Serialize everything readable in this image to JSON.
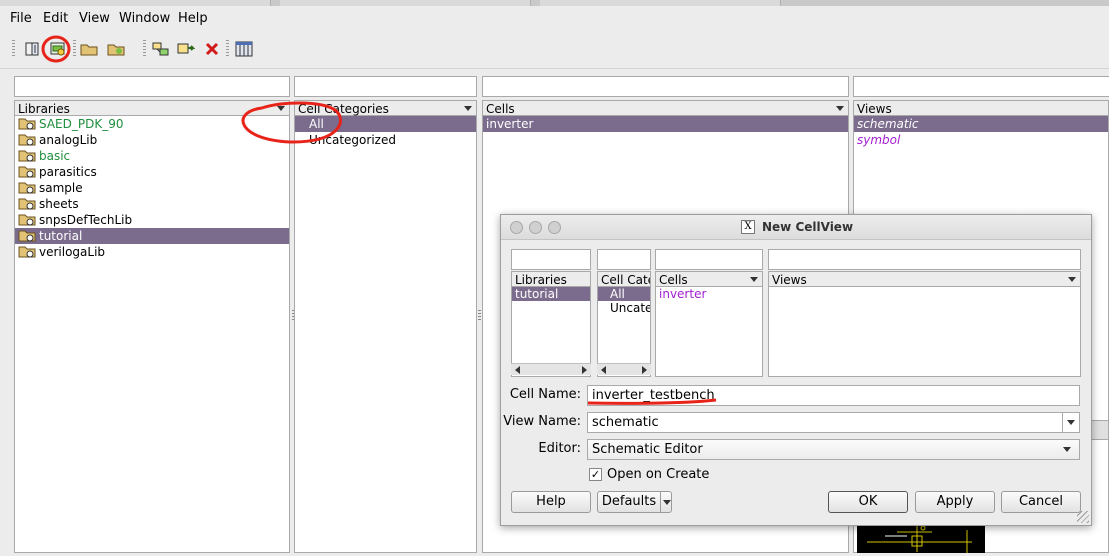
{
  "menubar": {
    "items": [
      "File",
      "Edit",
      "View",
      "Window",
      "Help"
    ]
  },
  "toolbar": {
    "icons": [
      "library-browser-icon",
      "new-cellview-icon",
      "open-folder-icon",
      "open-folder-dropdown-icon",
      "copy-icon",
      "rename-icon",
      "delete-icon",
      "grid-icon"
    ]
  },
  "libraries": {
    "header": "Libraries",
    "items": [
      {
        "label": "SAED_PDK_90",
        "color": "green"
      },
      {
        "label": "analogLib",
        "color": "black"
      },
      {
        "label": "basic",
        "color": "green"
      },
      {
        "label": "parasitics",
        "color": "black"
      },
      {
        "label": "sample",
        "color": "black"
      },
      {
        "label": "sheets",
        "color": "black"
      },
      {
        "label": "snpsDefTechLib",
        "color": "black"
      },
      {
        "label": "tutorial",
        "color": "black",
        "selected": true
      },
      {
        "label": "verilogaLib",
        "color": "black"
      }
    ]
  },
  "categories": {
    "header": "Cell Categories",
    "items": [
      "All",
      "Uncategorized"
    ]
  },
  "cells": {
    "header": "Cells",
    "items": [
      "inverter"
    ]
  },
  "views": {
    "header": "Views",
    "items": [
      "schematic",
      "symbol"
    ]
  },
  "dialog": {
    "title": "New CellView",
    "libraries_header": "Libraries",
    "libraries_selected": "tutorial",
    "categories_header": "Cell Cate",
    "categories_items": [
      "All",
      "Uncate"
    ],
    "cells_header": "Cells",
    "cells_items": [
      "inverter"
    ],
    "views_header": "Views",
    "cell_name_label": "Cell Name:",
    "cell_name_value": "inverter_testbench",
    "view_name_label": "View Name:",
    "view_name_value": "schematic",
    "editor_label": "Editor:",
    "editor_value": "Schematic Editor",
    "open_on_create_label": "Open on Create",
    "open_on_create_checked": true,
    "help_button": "Help",
    "defaults_button": "Defaults",
    "ok_button": "OK",
    "apply_button": "Apply",
    "cancel_button": "Cancel"
  },
  "annotation_color": "#e8231a",
  "selection_color": "#7b6b8d"
}
